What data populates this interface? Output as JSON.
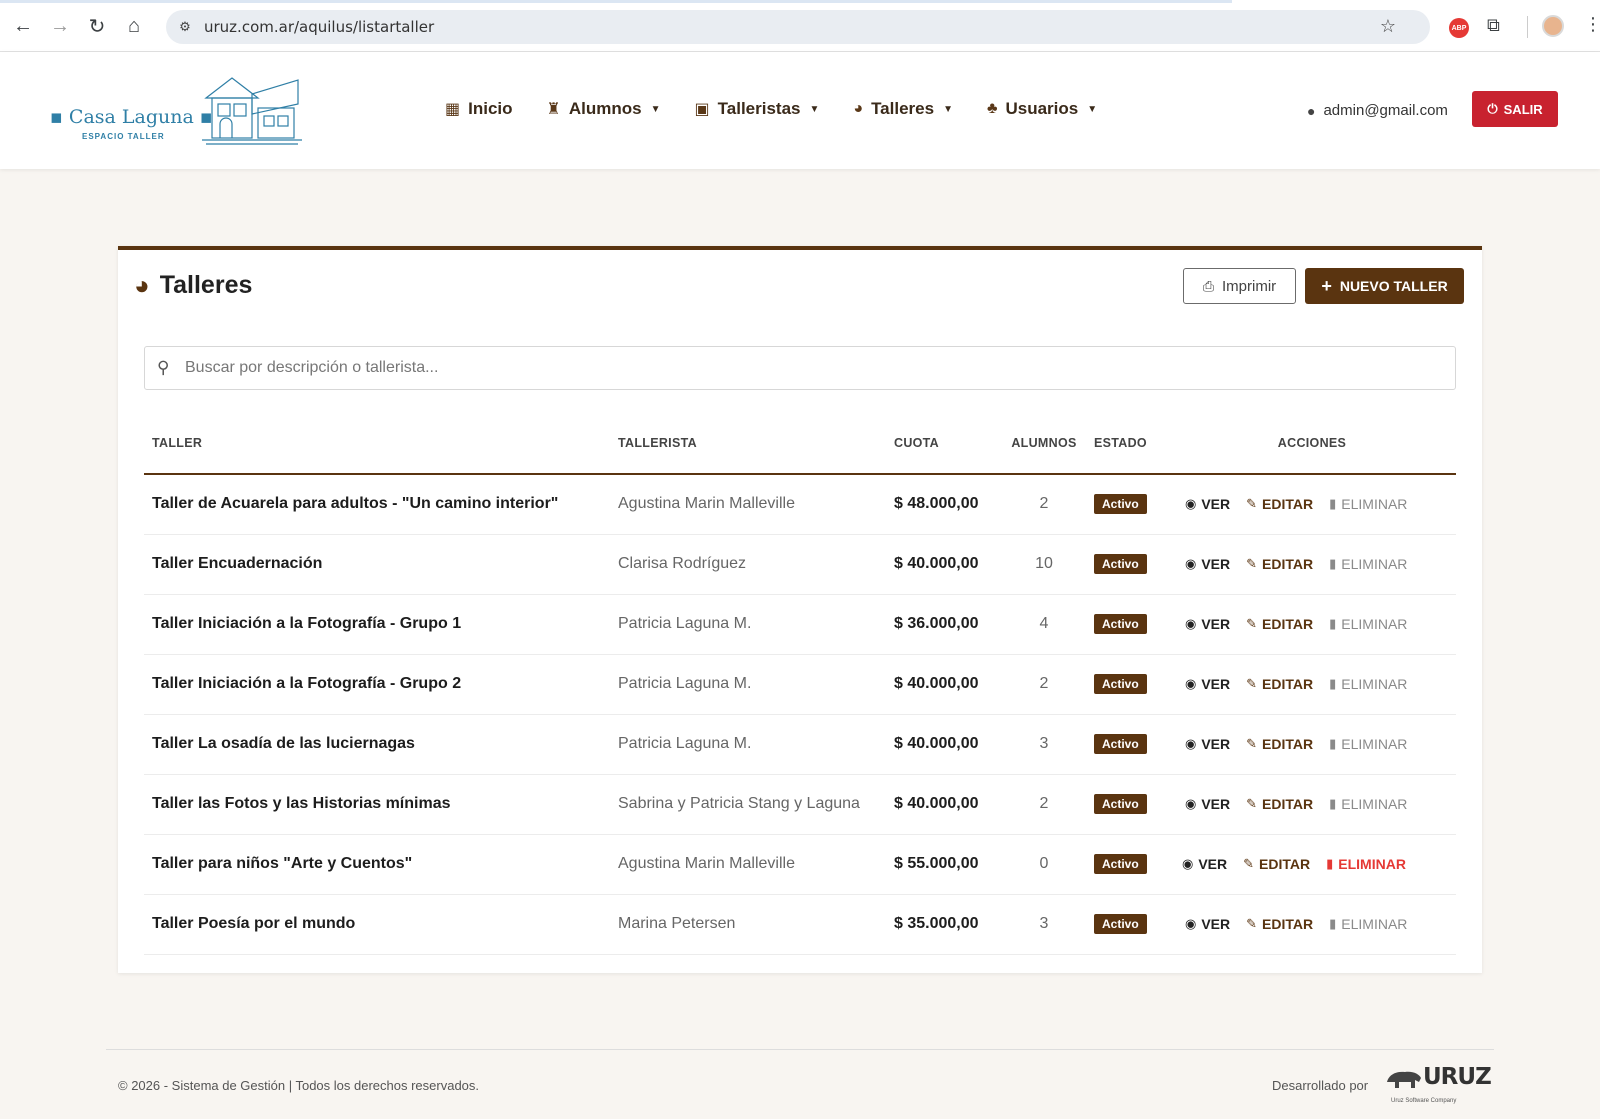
{
  "browser": {
    "url": "uruz.com.ar/aquilus/listartaller",
    "extension_badge": "ABP"
  },
  "logo": {
    "name": "Casa Laguna",
    "tagline": "ESPACIO TALLER"
  },
  "nav": {
    "items": [
      {
        "label": "Inicio",
        "icon": "grid-icon",
        "dropdown": false
      },
      {
        "label": "Alumnos",
        "icon": "student-icon",
        "dropdown": true
      },
      {
        "label": "Talleristas",
        "icon": "teacher-icon",
        "dropdown": true
      },
      {
        "label": "Talleres",
        "icon": "palette-icon",
        "dropdown": true
      },
      {
        "label": "Usuarios",
        "icon": "users-icon",
        "dropdown": true
      }
    ],
    "user_email": "admin@gmail.com",
    "logout_label": "SALIR"
  },
  "page": {
    "title": "Talleres",
    "print_label": "Imprimir",
    "new_label": "NUEVO TALLER",
    "search_placeholder": "Buscar por descripción o tallerista..."
  },
  "table": {
    "headers": {
      "taller": "TALLER",
      "tallerista": "TALLERISTA",
      "cuota": "CUOTA",
      "alumnos": "ALUMNOS",
      "estado": "ESTADO",
      "acciones": "ACCIONES"
    },
    "action_labels": {
      "view": "VER",
      "edit": "EDITAR",
      "delete": "ELIMINAR"
    },
    "rows": [
      {
        "taller": "Taller de Acuarela para adultos - \"Un camino interior\"",
        "tallerista": "Agustina Marin Malleville",
        "cuota": "$ 48.000,00",
        "alumnos": "2",
        "estado": "Activo"
      },
      {
        "taller": "Taller Encuadernación",
        "tallerista": "Clarisa Rodríguez",
        "cuota": "$ 40.000,00",
        "alumnos": "10",
        "estado": "Activo"
      },
      {
        "taller": "Taller Iniciación a la Fotografía - Grupo 1",
        "tallerista": "Patricia Laguna M.",
        "cuota": "$ 36.000,00",
        "alumnos": "4",
        "estado": "Activo"
      },
      {
        "taller": "Taller Iniciación a la Fotografía - Grupo 2",
        "tallerista": "Patricia Laguna M.",
        "cuota": "$ 40.000,00",
        "alumnos": "2",
        "estado": "Activo"
      },
      {
        "taller": "Taller La osadía de las luciernagas",
        "tallerista": "Patricia Laguna M.",
        "cuota": "$ 40.000,00",
        "alumnos": "3",
        "estado": "Activo"
      },
      {
        "taller": "Taller las Fotos y las Historias mínimas",
        "tallerista": "Sabrina y Patricia Stang y Laguna",
        "cuota": "$ 40.000,00",
        "alumnos": "2",
        "estado": "Activo"
      },
      {
        "taller": "Taller para niños \"Arte y Cuentos\"",
        "tallerista": "Agustina Marin Malleville",
        "cuota": "$ 55.000,00",
        "alumnos": "0",
        "estado": "Activo"
      },
      {
        "taller": "Taller Poesía por el mundo",
        "tallerista": "Marina Petersen",
        "cuota": "$ 35.000,00",
        "alumnos": "3",
        "estado": "Activo"
      }
    ]
  },
  "footer": {
    "copyright": "© 2026 - Sistema de Gestión | Todos los derechos reservados.",
    "developed_by": "Desarrollado por",
    "brand": "URUZ",
    "brand_sub": "Uruz Software Company"
  },
  "colors": {
    "brand_brown": "#5a3410",
    "danger": "#c8222f",
    "logo_blue": "#2f7fa6",
    "delete_active": "#e53935"
  }
}
